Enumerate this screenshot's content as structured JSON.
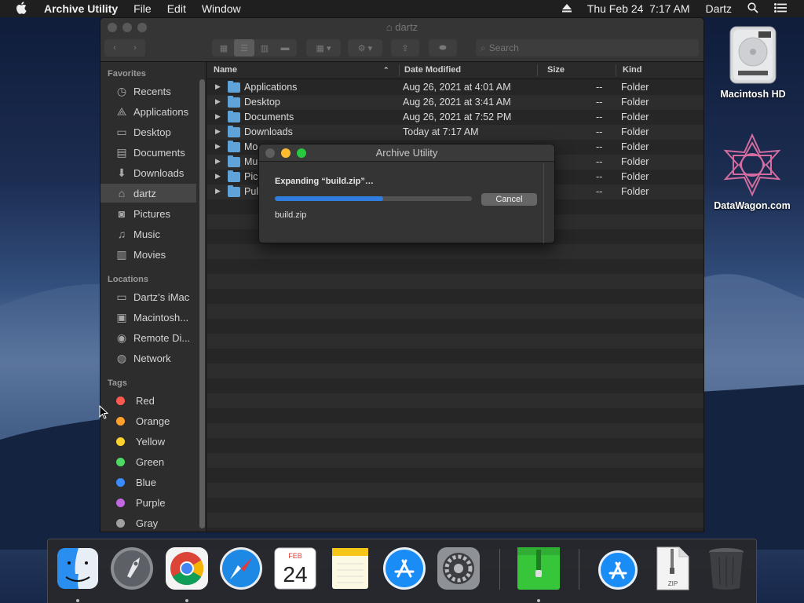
{
  "menubar": {
    "apple": "",
    "app_name": "Archive Utility",
    "menus": [
      "File",
      "Edit",
      "Window"
    ],
    "date_time": "Thu Feb 24  7:17 AM",
    "user": "Dartz",
    "icons": [
      "apple-icon",
      "eject-icon",
      "spotlight-search-icon",
      "control-center-icon"
    ]
  },
  "finder": {
    "title": "dartz",
    "search_placeholder": "Search",
    "sidebar": {
      "favorites_header": "Favorites",
      "favorites": [
        {
          "label": "Recents",
          "icon": "clock-icon"
        },
        {
          "label": "Applications",
          "icon": "applications-icon"
        },
        {
          "label": "Desktop",
          "icon": "desktop-icon"
        },
        {
          "label": "Documents",
          "icon": "document-icon"
        },
        {
          "label": "Downloads",
          "icon": "download-icon"
        },
        {
          "label": "dartz",
          "icon": "home-icon",
          "selected": true
        },
        {
          "label": "Pictures",
          "icon": "camera-icon"
        },
        {
          "label": "Music",
          "icon": "music-icon"
        },
        {
          "label": "Movies",
          "icon": "film-icon"
        }
      ],
      "locations_header": "Locations",
      "locations": [
        {
          "label": "Dartz’s iMac",
          "icon": "imac-icon"
        },
        {
          "label": "Macintosh...",
          "icon": "hard-drive-icon"
        },
        {
          "label": "Remote Di...",
          "icon": "disc-icon"
        },
        {
          "label": "Network",
          "icon": "globe-icon"
        }
      ],
      "tags_header": "Tags",
      "tags": [
        {
          "label": "Red",
          "color": "#ff5a52"
        },
        {
          "label": "Orange",
          "color": "#ffa02a"
        },
        {
          "label": "Yellow",
          "color": "#ffd32e"
        },
        {
          "label": "Green",
          "color": "#4cd964"
        },
        {
          "label": "Blue",
          "color": "#3b8cff"
        },
        {
          "label": "Purple",
          "color": "#c069e0"
        },
        {
          "label": "Gray",
          "color": "#a0a0a0"
        }
      ]
    },
    "columns": {
      "name": "Name",
      "date": "Date Modified",
      "size": "Size",
      "kind": "Kind"
    },
    "rows": [
      {
        "name": "Applications",
        "date": "Aug 26, 2021 at 4:01 AM",
        "size": "--",
        "kind": "Folder"
      },
      {
        "name": "Desktop",
        "date": "Aug 26, 2021 at 3:41 AM",
        "size": "--",
        "kind": "Folder"
      },
      {
        "name": "Documents",
        "date": "Aug 26, 2021 at 7:52 PM",
        "size": "--",
        "kind": "Folder"
      },
      {
        "name": "Downloads",
        "date": "Today at 7:17 AM",
        "size": "--",
        "kind": "Folder"
      },
      {
        "name": "Mo",
        "date": "",
        "size": "--",
        "kind": "Folder"
      },
      {
        "name": "Mu",
        "date": "",
        "size": "--",
        "kind": "Folder"
      },
      {
        "name": "Pic",
        "date": "",
        "size": "--",
        "kind": "Folder"
      },
      {
        "name": "Pul",
        "date": "",
        "size": "--",
        "kind": "Folder"
      }
    ]
  },
  "dialog": {
    "title": "Archive Utility",
    "message": "Expanding “build.zip”…",
    "progress": 0.55,
    "cancel_label": "Cancel",
    "filename": "build.zip"
  },
  "desktop": {
    "icons": [
      {
        "label": "Macintosh HD",
        "icon": "hard-drive-icon"
      },
      {
        "label": "DataWagon.com",
        "icon": "datawagon-logo-icon"
      }
    ]
  },
  "dock": {
    "apps": [
      "Finder",
      "Launchpad",
      "Google Chrome",
      "Safari",
      "Calendar",
      "Notes",
      "App Store",
      "System Preferences",
      "Archive Utility",
      "App Store Downloads",
      "ZIP Archive",
      "Trash"
    ],
    "calendar_month": "FEB",
    "calendar_day": "24",
    "zip_label": "ZIP"
  }
}
